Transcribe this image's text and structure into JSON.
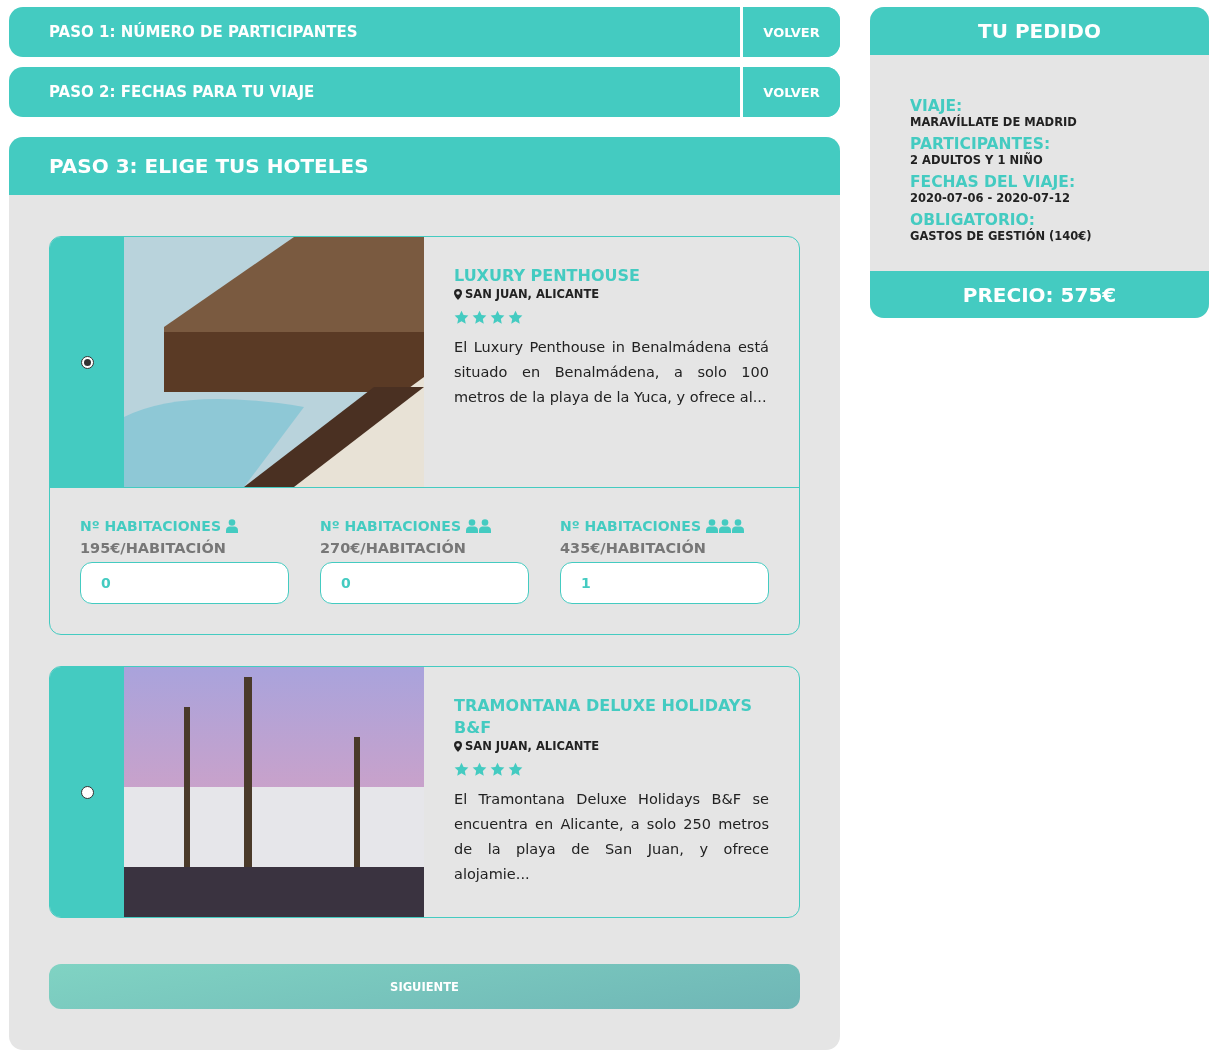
{
  "steps": [
    {
      "title": "PASO 1: NÚMERO DE PARTICIPANTES",
      "back": "VOLVER"
    },
    {
      "title": "PASO 2: FECHAS PARA TU VIAJE",
      "back": "VOLVER"
    }
  ],
  "current_step": {
    "title": "PASO 3: ELIGE TUS HOTELES",
    "hotels": [
      {
        "selected": true,
        "name": "LUXURY PENTHOUSE",
        "location": "SAN JUAN, ALICANTE",
        "stars": 4,
        "description": "El Luxury Penthouse in Benalmádena está situado en Benalmádena, a solo 100 metros de la playa de la Yuca, y ofrece al...",
        "rooms": [
          {
            "label": "Nº HABITACIONES",
            "price": "195€/HABITACIÓN",
            "value": "0"
          },
          {
            "label": "Nº HABITACIONES",
            "price": "270€/HABITACIÓN",
            "value": "0"
          },
          {
            "label": "Nº HABITACIONES",
            "price": "435€/HABITACIÓN",
            "value": "1"
          }
        ]
      },
      {
        "selected": false,
        "name": "TRAMONTANA DELUXE HOLIDAYS B&F",
        "location": "SAN JUAN, ALICANTE",
        "stars": 4,
        "description": "El Tramontana Deluxe Holidays B&F se encuentra en Alicante, a solo 250 metros de la playa de San Juan, y ofrece alojamie..."
      }
    ],
    "next": "SIGUIENTE"
  },
  "order": {
    "title": "TU PEDIDO",
    "items": [
      {
        "label": "VIAJE:",
        "value": "MARAVÍLLATE DE MADRID"
      },
      {
        "label": "PARTICIPANTES:",
        "value": "2 ADULTOS Y 1 NIÑO"
      },
      {
        "label": "FECHAS DEL VIAJE:",
        "value": "2020-07-06 - 2020-07-12"
      },
      {
        "label": "OBLIGATORIO:",
        "value": "GASTOS DE GESTIÓN (140€)"
      }
    ],
    "price": "PRECIO: 575€"
  }
}
